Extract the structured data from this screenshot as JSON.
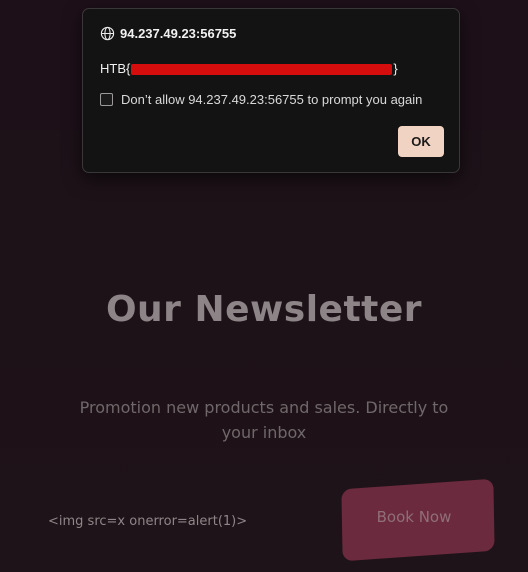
{
  "dialog": {
    "origin": "94.237.49.23:56755",
    "message_prefix": "HTB{",
    "message_suffix": "}",
    "checkbox_label": "Don’t allow 94.237.49.23:56755 to prompt you again",
    "checkbox_checked": false,
    "ok_label": "OK"
  },
  "page": {
    "headline": "Our Newsletter",
    "subtext": "Promotion new products and sales. Directly to your inbox",
    "injected_text": "<img src=x onerror=alert(1)>",
    "book_button_label": "Book Now"
  },
  "colors": {
    "background": "#1d1218",
    "dialog_bg": "#141313",
    "ok_button": "#f1d3c3",
    "redaction": "#d60d0d",
    "book_button": "#6b2a3d"
  },
  "icons": {
    "origin_icon": "globe-icon"
  }
}
